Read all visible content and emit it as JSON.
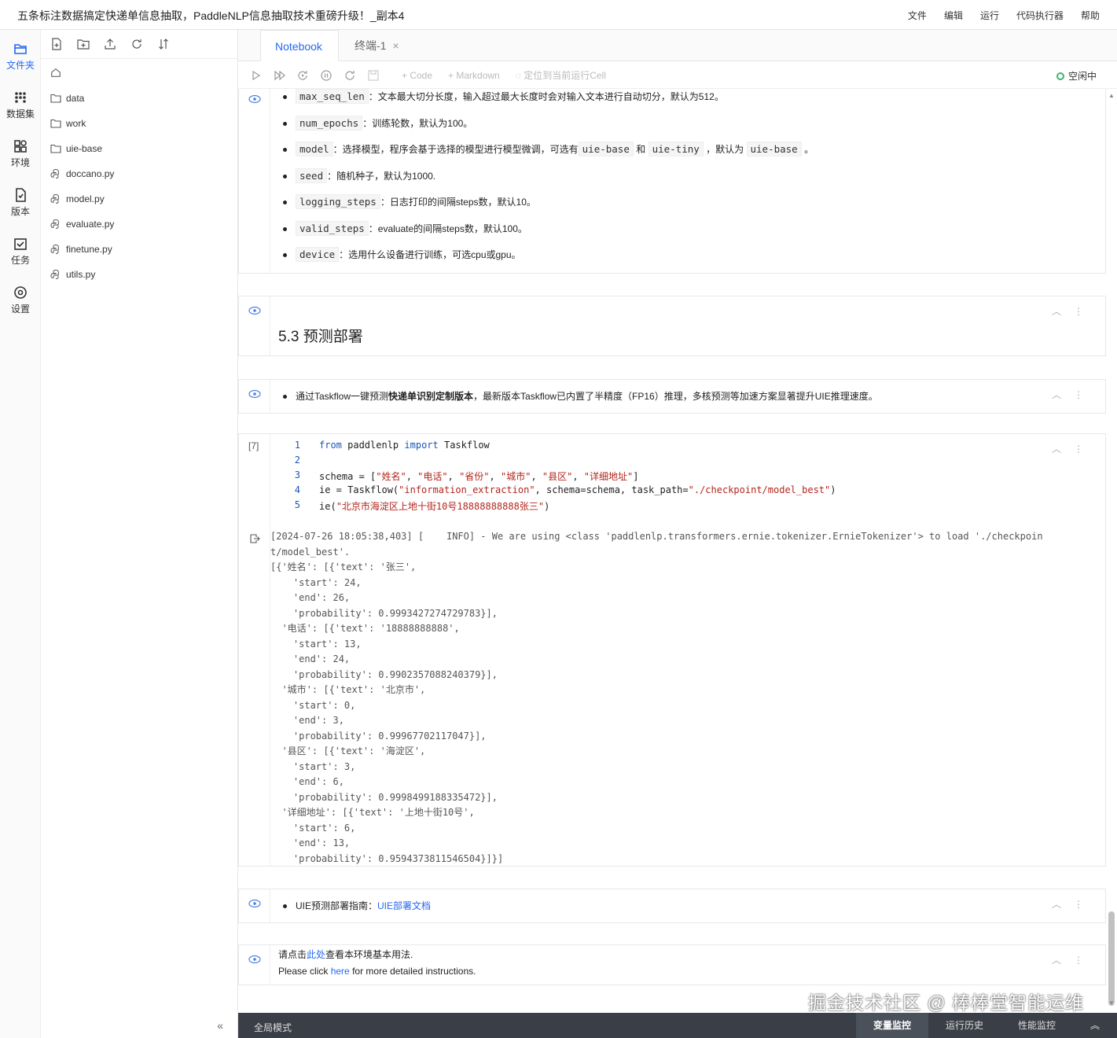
{
  "header": {
    "title": "五条标注数据搞定快递单信息抽取，PaddleNLP信息抽取技术重磅升级！_副本4",
    "menu": [
      "文件",
      "编辑",
      "运行",
      "代码执行器",
      "帮助"
    ]
  },
  "rail": {
    "items": [
      {
        "label": "文件夹",
        "icon": "folder-icon"
      },
      {
        "label": "数据集",
        "icon": "dataset-icon"
      },
      {
        "label": "环境",
        "icon": "environment-icon"
      },
      {
        "label": "版本",
        "icon": "version-icon"
      },
      {
        "label": "任务",
        "icon": "task-icon"
      },
      {
        "label": "设置",
        "icon": "settings-icon"
      }
    ]
  },
  "files": {
    "items": [
      {
        "name": "data",
        "type": "folder"
      },
      {
        "name": "work",
        "type": "folder"
      },
      {
        "name": "uie-base",
        "type": "folder"
      },
      {
        "name": "doccano.py",
        "type": "python"
      },
      {
        "name": "model.py",
        "type": "python"
      },
      {
        "name": "evaluate.py",
        "type": "python"
      },
      {
        "name": "finetune.py",
        "type": "python"
      },
      {
        "name": "utils.py",
        "type": "python"
      }
    ],
    "collapse": "«"
  },
  "tabs": {
    "notebook": "Notebook",
    "terminal": "终端-1",
    "close": "×"
  },
  "toolbar": {
    "code": "+ Code",
    "markdown": "+ Markdown",
    "locate": "定位到当前运行Cell",
    "status": "空闲中"
  },
  "cell1": {
    "params": [
      {
        "code": "max_seq_len",
        "text": "：文本最大切分长度，输入超过最大长度时会对输入文本进行自动切分，默认为512。"
      },
      {
        "code": "num_epochs",
        "text": "：训练轮数，默认为100。"
      },
      {
        "code": "model",
        "text": "：选择模型，程序会基于选择的模型进行模型微调，可选有",
        "c2": "uie-base",
        "t2": "和",
        "c3": "uie-tiny",
        "t3": "，默认为",
        "c4": "uie-base",
        "t4": "。"
      },
      {
        "code": "seed",
        "text": "：随机种子，默认为1000."
      },
      {
        "code": "logging_steps",
        "text": "：日志打印的间隔steps数，默认10。"
      },
      {
        "code": "valid_steps",
        "text": "：evaluate的间隔steps数，默认100。"
      },
      {
        "code": "device",
        "text": "：选用什么设备进行训练，可选cpu或gpu。"
      }
    ]
  },
  "cell2": {
    "heading": "5.3 预测部署"
  },
  "cell3": {
    "pre": "通过Taskflow一键预测",
    "bold": "快递单识别定制版本",
    "post": "，最新版本Taskflow已内置了半精度（FP16）推理，多核预测等加速方案显著提升UIE推理速度。"
  },
  "cell4": {
    "exec_count": "[7]",
    "lines": [
      "1",
      "2",
      "3",
      "4",
      "5"
    ],
    "output": "[2024-07-26 18:05:38,403] [    INFO] - We are using <class 'paddlenlp.transformers.ernie.tokenizer.ErnieTokenizer'> to load './checkpoin\nt/model_best'.\n[{'姓名': [{'text': '张三',\n    'start': 24,\n    'end': 26,\n    'probability': 0.9993427274729783}],\n  '电话': [{'text': '18888888888',\n    'start': 13,\n    'end': 24,\n    'probability': 0.9902357088240379}],\n  '城市': [{'text': '北京市',\n    'start': 0,\n    'end': 3,\n    'probability': 0.99967702117047}],\n  '县区': [{'text': '海淀区',\n    'start': 3,\n    'end': 6,\n    'probability': 0.9998499188335472}],\n  '详细地址': [{'text': '上地十街10号',\n    'start': 6,\n    'end': 13,\n    'probability': 0.9594373811546504}]}]"
  },
  "cell5": {
    "label": "UIE预测部署指南：",
    "link": "UIE部署文档"
  },
  "cell6": {
    "zh_pre": "请点击",
    "zh_link": "此处",
    "zh_post": "查看本环境基本用法.",
    "en_pre": "Please click ",
    "en_link": "here",
    "en_post": " for more detailed instructions."
  },
  "statusbar": {
    "left": "全局模式",
    "tabs": [
      "变量监控",
      "运行历史",
      "性能监控"
    ],
    "expand": "︽"
  },
  "watermark": "掘金技术社区 @ 棒棒堂智能运维"
}
